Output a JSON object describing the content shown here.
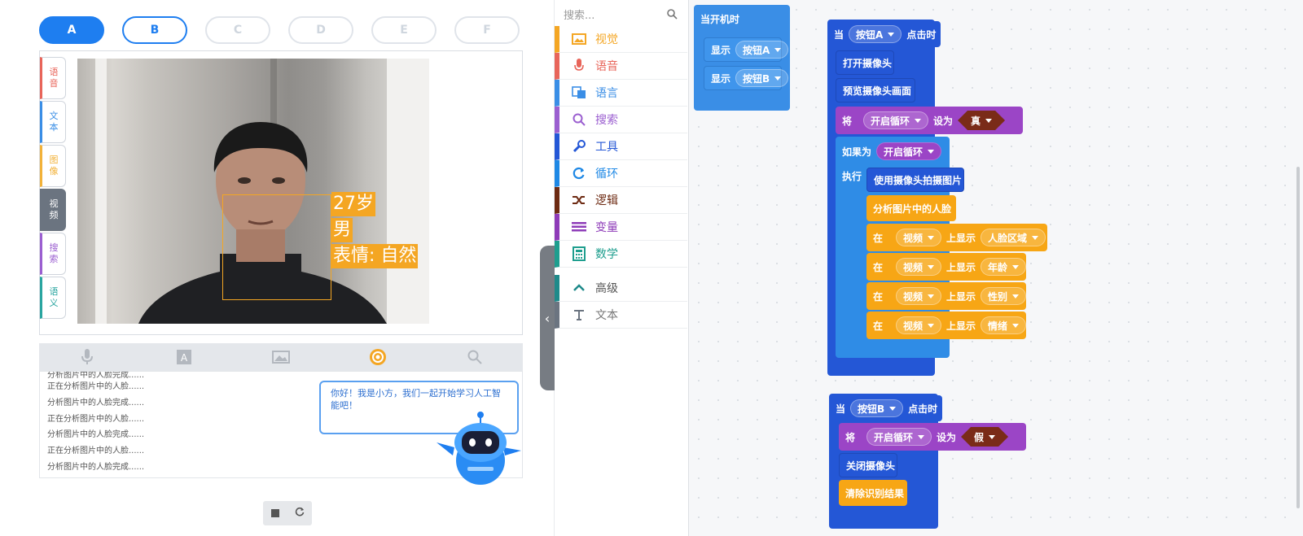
{
  "stage": {
    "buttons": [
      "A",
      "B",
      "C",
      "D",
      "E",
      "F"
    ],
    "side_tabs": [
      {
        "label": "语音",
        "color": "#e8655a"
      },
      {
        "label": "文本",
        "color": "#3a8ee6"
      },
      {
        "label": "图像",
        "color": "#f2b23a"
      },
      {
        "label": "视频",
        "color": "#6b7480"
      },
      {
        "label": "搜索",
        "color": "#9b5fd0"
      },
      {
        "label": "语义",
        "color": "#2aa5a0"
      }
    ],
    "result": {
      "age": "27岁",
      "gender": "男",
      "emotion": "表情: 自然"
    },
    "toolbar_icons": [
      "microphone-icon",
      "text-icon",
      "image-icon",
      "video-icon",
      "search-icon"
    ],
    "log_lines": [
      "分析图片中的人脸完成......",
      "正在分析图片中的人脸......",
      "分析图片中的人脸完成......",
      "正在分析图片中的人脸......",
      "分析图片中的人脸完成......",
      "正在分析图片中的人脸......",
      "分析图片中的人脸完成......"
    ],
    "assistant_message": "你好！我是小方，我们一起开始学习人工智能吧！"
  },
  "toolbox": {
    "search_placeholder": "搜索...",
    "categories": [
      {
        "label": "视觉",
        "color": "#f4a623",
        "icon": "image-icon"
      },
      {
        "label": "语音",
        "color": "#e8655a",
        "icon": "microphone-icon"
      },
      {
        "label": "语言",
        "color": "#3a8ee6",
        "icon": "translate-icon"
      },
      {
        "label": "搜索",
        "color": "#9b5fd0",
        "icon": "search-icon"
      },
      {
        "label": "工具",
        "color": "#2457d6",
        "icon": "wrench-icon"
      },
      {
        "label": "循环",
        "color": "#1e88e5",
        "icon": "loop-icon"
      },
      {
        "label": "逻辑",
        "color": "#6d2a12",
        "icon": "shuffle-icon"
      },
      {
        "label": "变量",
        "color": "#8e3bb8",
        "icon": "list-icon"
      },
      {
        "label": "数学",
        "color": "#1e9e8e",
        "icon": "calculator-icon"
      },
      {
        "label": "高级",
        "color": "#1e8a8a",
        "icon": "chevron-up-icon"
      },
      {
        "label": "文本",
        "color": "#6b7480",
        "icon": "text-icon"
      }
    ]
  },
  "blocks": {
    "start": {
      "title": "当开机时",
      "show": "显示",
      "btn_a": "按钮A",
      "btn_b": "按钮B"
    },
    "event_a": {
      "when": "当",
      "button": "按钮A",
      "clicked": "点击时",
      "open_camera": "打开摄像头",
      "preview": "预览摄像头画面",
      "set": "将",
      "var": "开启循环",
      "set_to": "设为",
      "true_val": "真",
      "if": "如果为",
      "do": "执行",
      "capture": "使用摄像头拍摄图片",
      "analyze": "分析图片中的人脸",
      "at": "在",
      "video": "视频",
      "show_on": "上显示",
      "face_area": "人脸区域",
      "age": "年龄",
      "gender": "性别",
      "emotion": "情绪"
    },
    "event_b": {
      "when": "当",
      "button": "按钮B",
      "clicked": "点击时",
      "set": "将",
      "var": "开启循环",
      "set_to": "设为",
      "false_val": "假",
      "close_camera": "关闭摄像头",
      "clear": "清除识别结果"
    }
  }
}
